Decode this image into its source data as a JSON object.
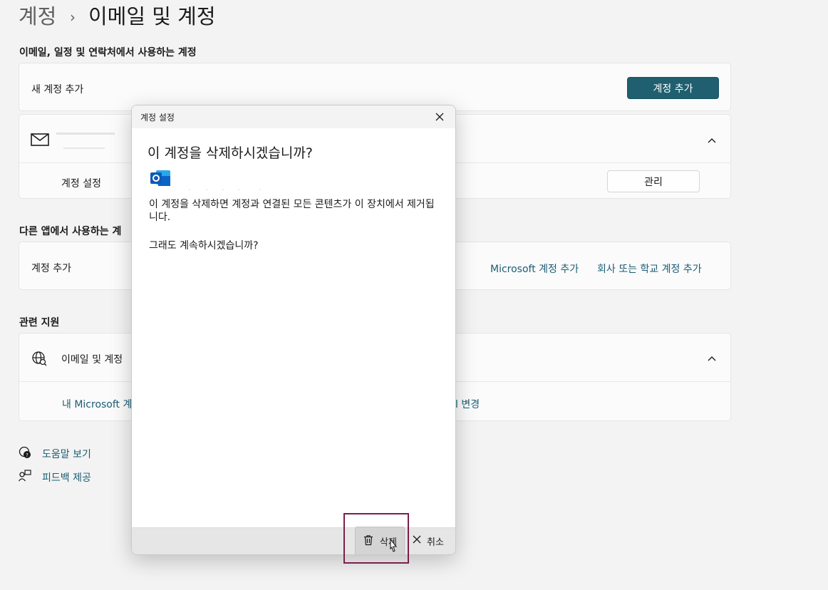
{
  "breadcrumb": {
    "parent": "계정",
    "separator": "›",
    "current": "이메일 및 계정"
  },
  "section_email": {
    "title": "이메일, 일정 및 연락처에서 사용하는 계정",
    "add_row_label": "새 계정 추가",
    "add_button": "계정 추가",
    "account_settings_label": "계정 설정",
    "manage_button": "관리"
  },
  "section_other": {
    "title": "다른 앱에서 사용하는 계",
    "add_row_label": "계정 추가",
    "link_ms": "Microsoft 계정 추가",
    "link_work": "회사 또는 학교 계정 추가"
  },
  "section_support": {
    "title": "관련 지원",
    "row_label": "이메일 및 계정",
    "link_ms_account": "내 Microsoft 계",
    "link_change": "l 변경"
  },
  "footer_links": {
    "help": "도움말 보기",
    "feedback": "피드백 제공"
  },
  "dialog": {
    "caption": "계정 설정",
    "heading": "이 계정을 삭제하시겠습니까?",
    "body": "이 계정을 삭제하면 계정과 연결된 모든 콘텐츠가 이 장치에서 제거됩니다.",
    "question": "그래도 계속하시겠습니까?",
    "delete_button": "삭제",
    "cancel_button": "취소"
  },
  "colors": {
    "accent": "#1f5f6f",
    "link": "#1a5d73",
    "highlight": "#7a1f4f",
    "outlook_blue": "#0a64c8"
  },
  "icons": [
    "mail-icon",
    "chevron-up-icon",
    "globe-icon",
    "help-icon",
    "feedback-icon",
    "close-icon",
    "outlook-icon",
    "trash-icon",
    "cursor-icon"
  ]
}
